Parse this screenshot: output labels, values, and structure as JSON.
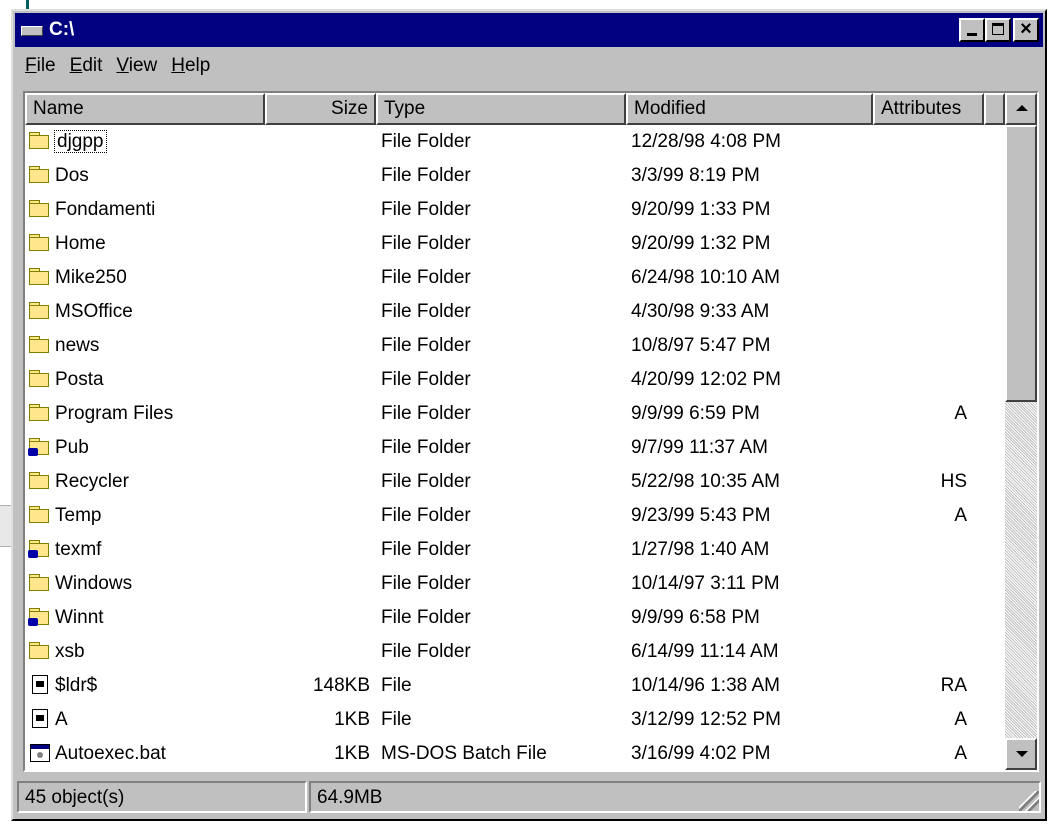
{
  "window": {
    "title": "C:\\"
  },
  "menu": [
    {
      "pre": "",
      "key": "F",
      "post": "ile"
    },
    {
      "pre": "",
      "key": "E",
      "post": "dit"
    },
    {
      "pre": "",
      "key": "V",
      "post": "iew"
    },
    {
      "pre": "",
      "key": "H",
      "post": "elp"
    }
  ],
  "columns": {
    "name": "Name",
    "size": "Size",
    "type": "Type",
    "modified": "Modified",
    "attributes": "Attributes"
  },
  "rows": [
    {
      "icon": "folder-icon",
      "name": "djgpp",
      "size": "",
      "type": "File Folder",
      "modified": "12/28/98 4:08 PM",
      "attributes": ""
    },
    {
      "icon": "folder-icon",
      "name": "Dos",
      "size": "",
      "type": "File Folder",
      "modified": "3/3/99 8:19 PM",
      "attributes": ""
    },
    {
      "icon": "folder-icon",
      "name": "Fondamenti",
      "size": "",
      "type": "File Folder",
      "modified": "9/20/99 1:33 PM",
      "attributes": ""
    },
    {
      "icon": "folder-icon",
      "name": "Home",
      "size": "",
      "type": "File Folder",
      "modified": "9/20/99 1:32 PM",
      "attributes": ""
    },
    {
      "icon": "folder-icon",
      "name": "Mike250",
      "size": "",
      "type": "File Folder",
      "modified": "6/24/98 10:10 AM",
      "attributes": ""
    },
    {
      "icon": "folder-icon",
      "name": "MSOffice",
      "size": "",
      "type": "File Folder",
      "modified": "4/30/98 9:33 AM",
      "attributes": ""
    },
    {
      "icon": "folder-icon",
      "name": "news",
      "size": "",
      "type": "File Folder",
      "modified": "10/8/97 5:47 PM",
      "attributes": ""
    },
    {
      "icon": "folder-icon",
      "name": "Posta",
      "size": "",
      "type": "File Folder",
      "modified": "4/20/99 12:02 PM",
      "attributes": ""
    },
    {
      "icon": "folder-icon",
      "name": "Program Files",
      "size": "",
      "type": "File Folder",
      "modified": "9/9/99 6:59 PM",
      "attributes": "A"
    },
    {
      "icon": "shared-folder-icon",
      "name": "Pub",
      "size": "",
      "type": "File Folder",
      "modified": "9/7/99 11:37 AM",
      "attributes": ""
    },
    {
      "icon": "folder-icon",
      "name": "Recycler",
      "size": "",
      "type": "File Folder",
      "modified": "5/22/98 10:35 AM",
      "attributes": "HS"
    },
    {
      "icon": "folder-icon",
      "name": "Temp",
      "size": "",
      "type": "File Folder",
      "modified": "9/23/99 5:43 PM",
      "attributes": "A"
    },
    {
      "icon": "shared-folder-icon",
      "name": "texmf",
      "size": "",
      "type": "File Folder",
      "modified": "1/27/98 1:40 AM",
      "attributes": ""
    },
    {
      "icon": "folder-icon",
      "name": "Windows",
      "size": "",
      "type": "File Folder",
      "modified": "10/14/97 3:11 PM",
      "attributes": ""
    },
    {
      "icon": "shared-folder-icon",
      "name": "Winnt",
      "size": "",
      "type": "File Folder",
      "modified": "9/9/99 6:58 PM",
      "attributes": ""
    },
    {
      "icon": "folder-icon",
      "name": "xsb",
      "size": "",
      "type": "File Folder",
      "modified": "6/14/99 11:14 AM",
      "attributes": ""
    },
    {
      "icon": "file-icon",
      "name": "$ldr$",
      "size": "148KB",
      "type": "File",
      "modified": "10/14/96 1:38 AM",
      "attributes": "RA"
    },
    {
      "icon": "file-icon",
      "name": "A",
      "size": "1KB",
      "type": "File",
      "modified": "3/12/99 12:52 PM",
      "attributes": "A"
    },
    {
      "icon": "batch-file-icon",
      "name": "Autoexec.bat",
      "size": "1KB",
      "type": "MS-DOS Batch File",
      "modified": "3/16/99 4:02 PM",
      "attributes": "A"
    }
  ],
  "status": {
    "objects": "45 object(s)",
    "size": "64.9MB"
  }
}
